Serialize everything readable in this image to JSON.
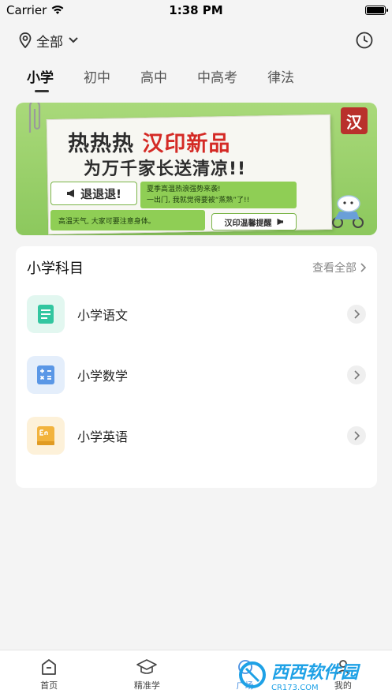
{
  "status_bar": {
    "carrier": "Carrier",
    "time": "1:38 PM"
  },
  "location": {
    "label": "全部"
  },
  "tabs": [
    {
      "label": "小学",
      "active": true
    },
    {
      "label": "初中",
      "active": false
    },
    {
      "label": "高中",
      "active": false
    },
    {
      "label": "中高考",
      "active": false
    },
    {
      "label": "律法",
      "active": false
    }
  ],
  "banner": {
    "title_prefix": "热热热",
    "title_brand": "汉印新品",
    "subtitle": "为万千家长送清凉!!",
    "pill1": "退退退!",
    "note1_line1": "夏季高温热浪强势来袭!",
    "note1_line2": "一出门, 我就觉得要被“蒸熟”了!!",
    "note2": "高温天气, 大家可要注意身体。",
    "pill2": "汉印温馨提醒",
    "logo_text": "汉"
  },
  "subjects_card": {
    "title": "小学科目",
    "view_all": "查看全部",
    "items": [
      {
        "label": "小学语文",
        "icon": "document-icon",
        "color": "#32c6a0",
        "bg": "#e2f7f0"
      },
      {
        "label": "小学数学",
        "icon": "calculator-icon",
        "color": "#5a97e6",
        "bg": "#e4eefb"
      },
      {
        "label": "小学英语",
        "icon": "english-book-icon",
        "color": "#f2b33d",
        "bg": "#fdf1d9"
      }
    ]
  },
  "bottom_nav": [
    {
      "label": "首页",
      "icon": "home-icon",
      "active": false
    },
    {
      "label": "精准学",
      "icon": "graduation-cap-icon",
      "active": false
    },
    {
      "label": "广场",
      "icon": "plaza-icon",
      "active": true
    },
    {
      "label": "我的",
      "icon": "profile-icon",
      "active": false
    }
  ],
  "watermark": {
    "text": "西西软件园",
    "sub": "CR173.COM"
  }
}
